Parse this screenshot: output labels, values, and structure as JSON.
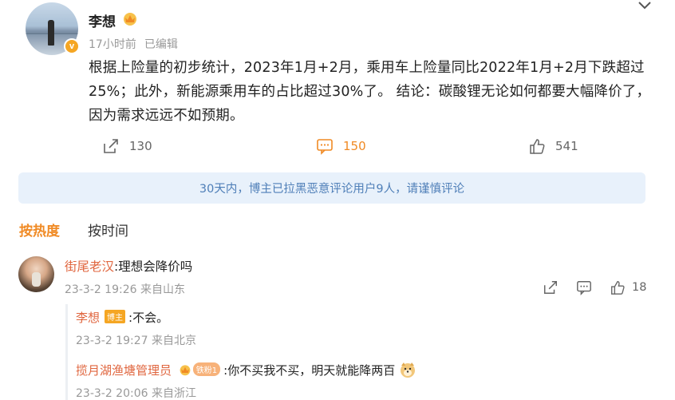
{
  "post": {
    "author": "李想",
    "time": "17小时前",
    "edited": "已编辑",
    "verified_badge": "v",
    "text": "根据上险量的初步统计，2023年1月+2月，乘用车上险量同比2022年1月+2月下跌超过25%；此外，新能源乘用车的占比超过30%了。 结论：碳酸锂无论如何都要大幅降价了，因为需求远远不如预期。",
    "reposts": "130",
    "comments": "150",
    "likes": "541",
    "icons": [
      "crown-icon",
      "chevron-down-icon",
      "repost-icon",
      "comment-icon",
      "like-icon"
    ]
  },
  "notice": "30天内，博主已拉黑恶意评论用户9人，请谨慎评论",
  "sort": {
    "hot": "按热度",
    "time": "按时间"
  },
  "comment": {
    "author": "街尾老汉",
    "text": ":理想会降价吗",
    "meta": "23-3-2 19:26 来自山东",
    "likes": "18"
  },
  "replies": [
    {
      "author": "李想",
      "tag": "博主",
      "text": ":不会。",
      "meta": "23-3-2 19:27 来自北京"
    },
    {
      "author": "揽月湖渔塘管理员",
      "tag": "铁粉1",
      "text": ":你不买我不买，明天就能降两百",
      "meta": "23-3-2 20:06 来自浙江"
    }
  ],
  "colors": {
    "accent": "#f08a24",
    "username": "#e0663f",
    "notice_bg": "#e8f1fb",
    "notice_text": "#4f7fb8"
  }
}
